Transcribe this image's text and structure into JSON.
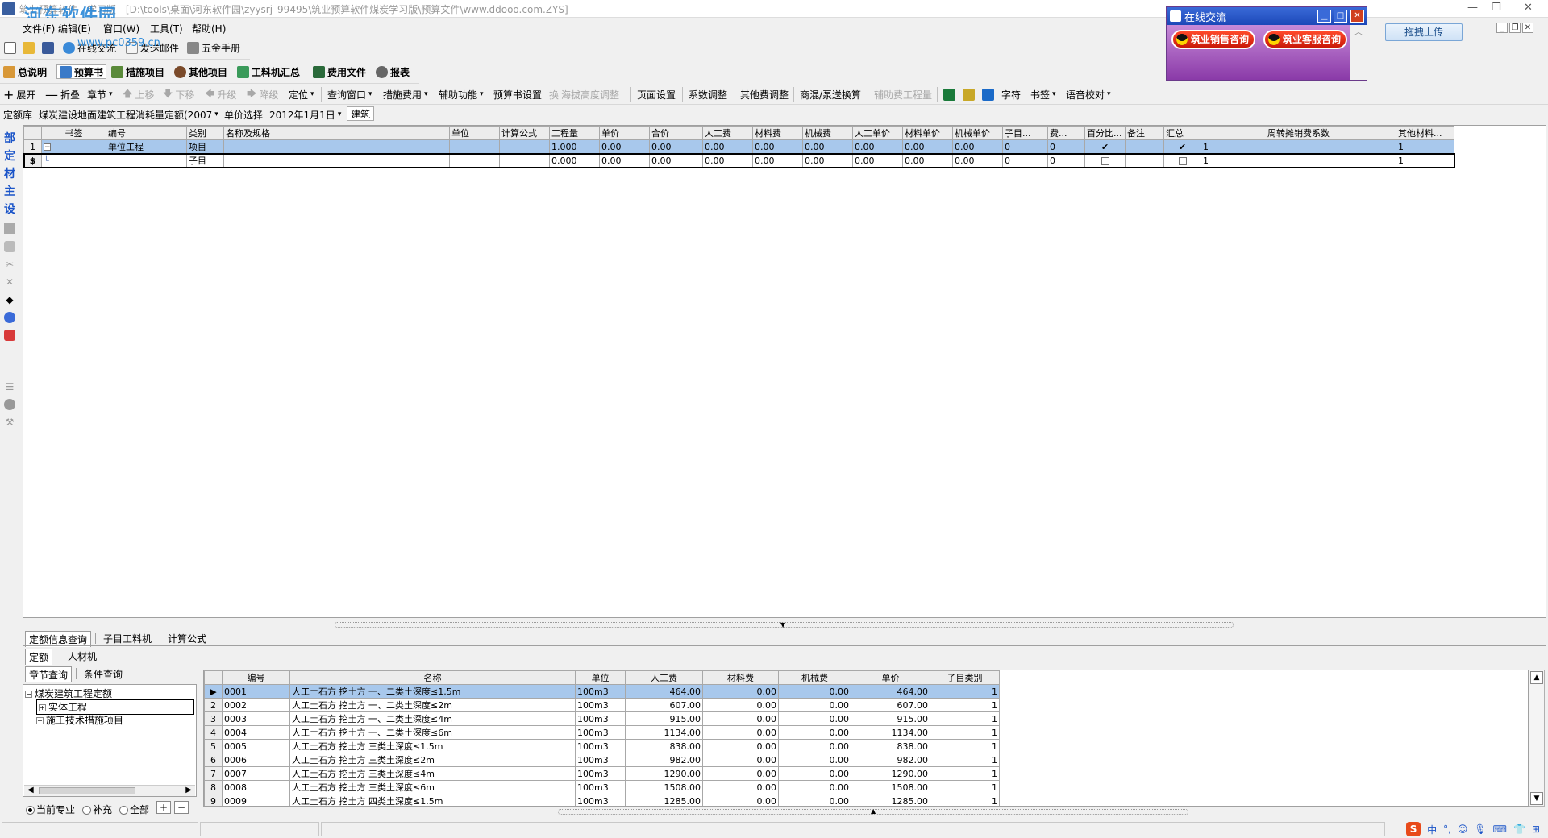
{
  "window": {
    "title": "筑业预算软件 - 学习版 - [D:\\tools\\桌面\\河东软件园\\zyysrj_99495\\筑业预算软件煤炭学习版\\预算文件\\www.ddooo.com.ZYS]",
    "watermark": "河东软件园",
    "watermark_url": "www.pc0359.cn"
  },
  "menubar": {
    "items": [
      "文件(F)",
      "编辑(E)",
      "窗口(W)",
      "工具(T)",
      "帮助(H)"
    ]
  },
  "toolbar1": {
    "items": [
      "在线交流",
      "发送邮件",
      "五金手册"
    ]
  },
  "toolbar2": {
    "items": [
      "总说明",
      "预算书",
      "措施项目",
      "其他项目",
      "工料机汇总",
      "费用文件",
      "报表"
    ]
  },
  "toolbar3": {
    "items": [
      "展开",
      "折叠",
      "章节",
      "上移",
      "下移",
      "升级",
      "降级",
      "定位",
      "查询窗口",
      "措施费用",
      "辅助功能",
      "预算书设置",
      "海拔高度调整",
      "页面设置",
      "系数调整",
      "其他费调整",
      "商混/泵送换算",
      "辅助费工程量",
      "字符",
      "书签",
      "语音校对"
    ],
    "huan": "换"
  },
  "quota_bar": {
    "label": "定额库",
    "library": "煤炭建设地面建筑工程消耗量定额(2007",
    "price_label": "单价选择",
    "price_value": "2012年1月1日",
    "profession": "建筑"
  },
  "chat_popup": {
    "title": "在线交流",
    "sales_btn": "筑业销售咨询",
    "service_btn": "筑业客服咨询"
  },
  "upload_btn": "拖拽上传",
  "leftbar": {
    "labels": [
      "部",
      "定",
      "材",
      "主",
      "设"
    ]
  },
  "main_grid": {
    "columns": [
      "书签",
      "编号",
      "类别",
      "名称及规格",
      "单位",
      "计算公式",
      "工程量",
      "单价",
      "合价",
      "人工费",
      "材料费",
      "机械费",
      "人工单价",
      "材料单价",
      "机械单价",
      "子目...",
      "费...",
      "百分比...",
      "备注",
      "汇总",
      "周转摊销费系数",
      "其他材料..."
    ],
    "rows": [
      {
        "idx": "1",
        "code": "单位工程",
        "type": "项目",
        "name": "",
        "unit": "",
        "formula": "",
        "qty": "1.000",
        "price": "0.00",
        "total": "0.00",
        "labor": "0.00",
        "material": "0.00",
        "machine": "0.00",
        "lp": "0.00",
        "mp": "0.00",
        "mcp": "0.00",
        "sub": "0",
        "fee": "0",
        "pct": "✔",
        "note": "",
        "sum": "✔",
        "coef": "1",
        "other": "1"
      },
      {
        "idx": "$",
        "code": "",
        "type": "子目",
        "name": "",
        "unit": "",
        "formula": "",
        "qty": "0.000",
        "price": "0.00",
        "total": "0.00",
        "labor": "0.00",
        "material": "0.00",
        "machine": "0.00",
        "lp": "0.00",
        "mp": "0.00",
        "mcp": "0.00",
        "sub": "0",
        "fee": "0",
        "pct": "",
        "note": "",
        "sum": "",
        "coef": "1",
        "other": "1"
      }
    ]
  },
  "bottom_tabs": [
    "定额信息查询",
    "子目工料机",
    "计算公式"
  ],
  "sub_tabs": [
    "定额",
    "人材机"
  ],
  "query_tabs": [
    "章节查询",
    "条件查询"
  ],
  "tree": {
    "root": "煤炭建筑工程定额",
    "children": [
      "实体工程",
      "施工技术措施项目"
    ]
  },
  "radios": {
    "options": [
      "当前专业",
      "补充",
      "全部"
    ],
    "plus": "+",
    "minus": "−"
  },
  "quota_table": {
    "columns": [
      "编号",
      "名称",
      "单位",
      "人工费",
      "材料费",
      "机械费",
      "单价",
      "子目类别"
    ],
    "rows": [
      {
        "idx": "▶",
        "code": "0001",
        "name": "人工土石方 挖土方 一、二类土深度≤1.5m",
        "unit": "100m3",
        "labor": "464.00",
        "material": "0.00",
        "machine": "0.00",
        "price": "464.00",
        "cat": "1"
      },
      {
        "idx": "2",
        "code": "0002",
        "name": "人工土石方 挖土方 一、二类土深度≤2m",
        "unit": "100m3",
        "labor": "607.00",
        "material": "0.00",
        "machine": "0.00",
        "price": "607.00",
        "cat": "1"
      },
      {
        "idx": "3",
        "code": "0003",
        "name": "人工土石方 挖土方 一、二类土深度≤4m",
        "unit": "100m3",
        "labor": "915.00",
        "material": "0.00",
        "machine": "0.00",
        "price": "915.00",
        "cat": "1"
      },
      {
        "idx": "4",
        "code": "0004",
        "name": "人工土石方 挖土方 一、二类土深度≤6m",
        "unit": "100m3",
        "labor": "1134.00",
        "material": "0.00",
        "machine": "0.00",
        "price": "1134.00",
        "cat": "1"
      },
      {
        "idx": "5",
        "code": "0005",
        "name": "人工土石方 挖土方 三类土深度≤1.5m",
        "unit": "100m3",
        "labor": "838.00",
        "material": "0.00",
        "machine": "0.00",
        "price": "838.00",
        "cat": "1"
      },
      {
        "idx": "6",
        "code": "0006",
        "name": "人工土石方 挖土方 三类土深度≤2m",
        "unit": "100m3",
        "labor": "982.00",
        "material": "0.00",
        "machine": "0.00",
        "price": "982.00",
        "cat": "1"
      },
      {
        "idx": "7",
        "code": "0007",
        "name": "人工土石方 挖土方 三类土深度≤4m",
        "unit": "100m3",
        "labor": "1290.00",
        "material": "0.00",
        "machine": "0.00",
        "price": "1290.00",
        "cat": "1"
      },
      {
        "idx": "8",
        "code": "0008",
        "name": "人工土石方 挖土方 三类土深度≤6m",
        "unit": "100m3",
        "labor": "1508.00",
        "material": "0.00",
        "machine": "0.00",
        "price": "1508.00",
        "cat": "1"
      },
      {
        "idx": "9",
        "code": "0009",
        "name": "人工土石方 挖土方 四类土深度≤1.5m",
        "unit": "100m3",
        "labor": "1285.00",
        "material": "0.00",
        "machine": "0.00",
        "price": "1285.00",
        "cat": "1"
      }
    ]
  },
  "ime": {
    "logo": "S",
    "mode": "中"
  }
}
